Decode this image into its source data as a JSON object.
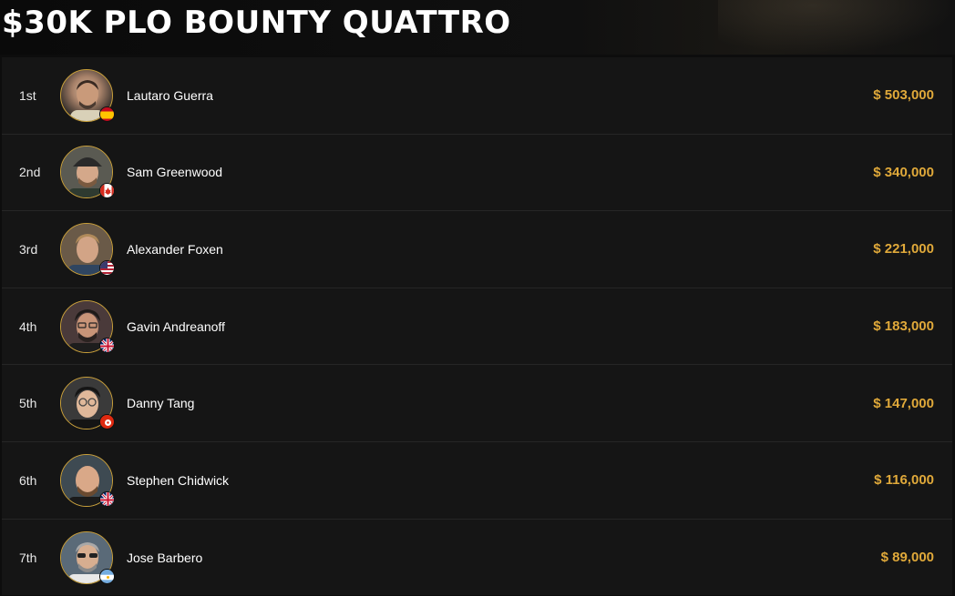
{
  "title": "$30K PLO BOUNTY QUATTRO",
  "accent_color": "#e0a93a",
  "results": [
    {
      "rank": "1st",
      "name": "Lautaro Guerra",
      "prize": "$ 503,000",
      "flag": "spain-flag-icon"
    },
    {
      "rank": "2nd",
      "name": "Sam Greenwood",
      "prize": "$ 340,000",
      "flag": "canada-flag-icon"
    },
    {
      "rank": "3rd",
      "name": "Alexander Foxen",
      "prize": "$ 221,000",
      "flag": "usa-flag-icon"
    },
    {
      "rank": "4th",
      "name": "Gavin Andreanoff",
      "prize": "$ 183,000",
      "flag": "uk-flag-icon"
    },
    {
      "rank": "5th",
      "name": "Danny Tang",
      "prize": "$ 147,000",
      "flag": "hong-kong-flag-icon"
    },
    {
      "rank": "6th",
      "name": "Stephen Chidwick",
      "prize": "$ 116,000",
      "flag": "uk-flag-icon"
    },
    {
      "rank": "7th",
      "name": "Jose Barbero",
      "prize": "$ 89,000",
      "flag": "argentina-flag-icon"
    }
  ]
}
